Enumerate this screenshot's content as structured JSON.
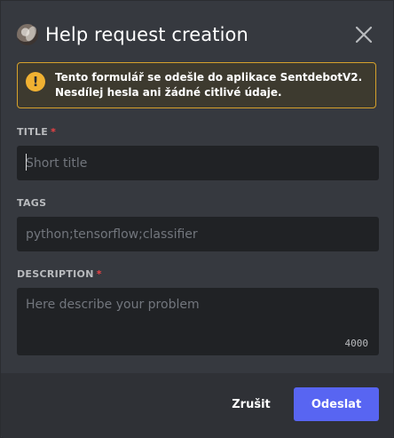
{
  "header": {
    "title": "Help request creation",
    "avatar_icon": "app-avatar",
    "close_icon": "close-icon"
  },
  "alert": {
    "icon": "warning-icon",
    "icon_glyph": "!",
    "text_before": "Tento formulář se odešle do aplikace ",
    "app_name": "SentdebotV2",
    "text_after": ". Nesdílej hesla ani žádné citlivé údaje.",
    "accent_color": "#f0b132"
  },
  "form": {
    "title": {
      "label": "TITLE",
      "required_marker": "*",
      "placeholder": "Short title",
      "value": ""
    },
    "tags": {
      "label": "TAGS",
      "placeholder": "python;tensorflow;classifier",
      "value": ""
    },
    "description": {
      "label": "DESCRIPTION",
      "required_marker": "*",
      "placeholder": "Here describe your problem",
      "value": "",
      "char_limit": "4000"
    }
  },
  "footer": {
    "cancel_label": "Zrušit",
    "submit_label": "Odeslat",
    "submit_color": "#5865f2"
  }
}
